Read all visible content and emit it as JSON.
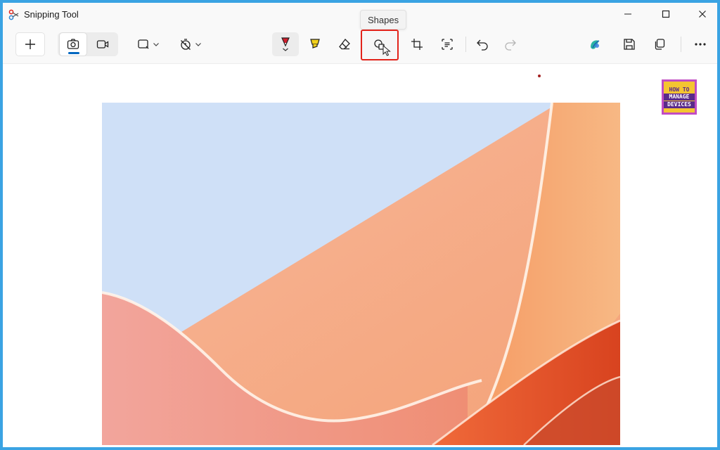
{
  "window": {
    "title": "Snipping Tool",
    "controls": [
      "minimize-icon",
      "maximize-icon",
      "close-icon"
    ]
  },
  "tooltip": {
    "text": "Shapes"
  },
  "toolbar": {
    "new_icon": "plus-icon",
    "modes": [
      {
        "name": "screenshot",
        "icon": "camera-icon",
        "selected": true
      },
      {
        "name": "recording",
        "icon": "video-icon",
        "selected": false
      }
    ],
    "snip_mode_icon": "rectangle-snip-icon",
    "delay_icon": "no-timer-icon",
    "tools": [
      {
        "name": "ballpoint-pen",
        "icon": "pen-icon",
        "color": "#d11f2d"
      },
      {
        "name": "highlighter",
        "icon": "highlighter-icon",
        "color": "#f2d11b"
      },
      {
        "name": "eraser",
        "icon": "eraser-icon"
      },
      {
        "name": "shapes",
        "icon": "shapes-icon",
        "highlighted": true
      },
      {
        "name": "crop",
        "icon": "crop-icon"
      },
      {
        "name": "text-actions",
        "icon": "text-actions-icon"
      },
      {
        "name": "undo",
        "icon": "undo-icon"
      },
      {
        "name": "redo",
        "icon": "redo-icon",
        "disabled": true
      }
    ],
    "right_actions": [
      "copilot-icon",
      "save-icon",
      "copy-icon",
      "more-icon"
    ]
  },
  "canvas": {
    "image": "abstract-wave-wallpaper",
    "colors": {
      "sky": "#cfe0f7",
      "peach": "#f6b07c",
      "coral": "#ef8a74",
      "deep": "#e2522a"
    }
  },
  "watermark": {
    "line1": "HOW TO",
    "line2": "MANAGE",
    "line3": "DEVICES"
  },
  "colors": {
    "accent": "#0067c0",
    "highlight_box": "#e2231a",
    "frame_border": "#3aa3e3"
  }
}
